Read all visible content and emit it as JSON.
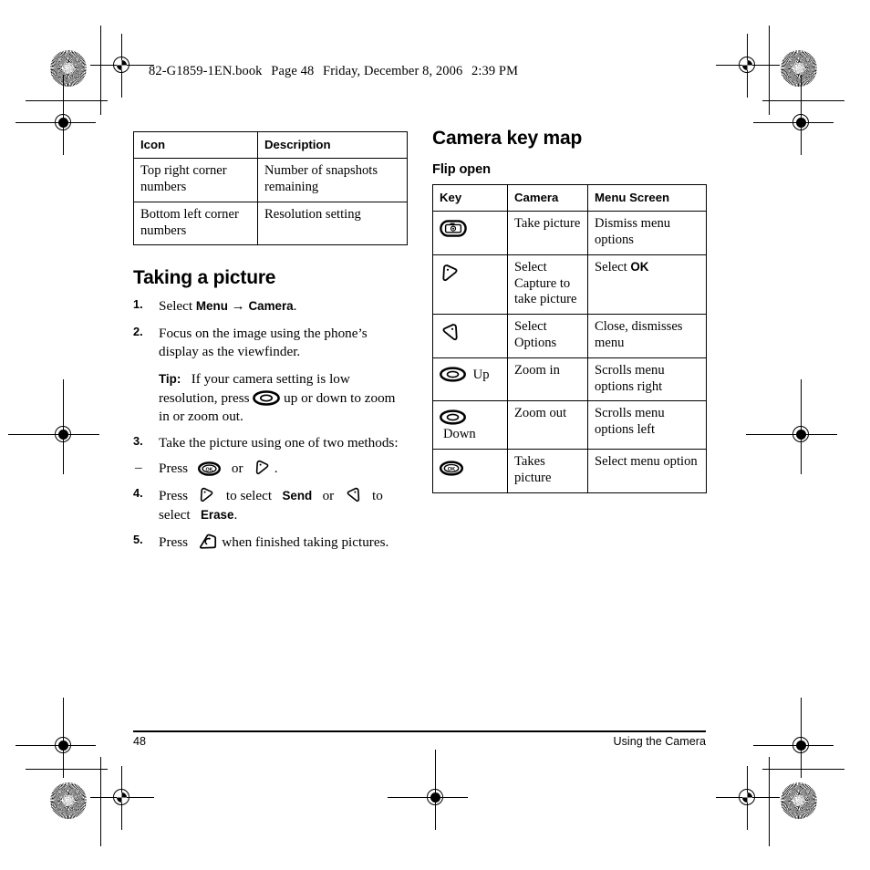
{
  "document": {
    "header_line": "82-G1859-1EN.book  Page 48  Friday, December 8, 2006  2:39 PM",
    "header_file": "82-G1859-1EN.book",
    "header_page": "Page 48",
    "header_date": "Friday, December 8, 2006",
    "header_time": "2:39 PM"
  },
  "icon_table": {
    "headers": [
      "Icon",
      "Description"
    ],
    "rows": [
      {
        "icon": "Top right corner numbers",
        "description": "Number of snapshots remaining"
      },
      {
        "icon": "Bottom left corner numbers",
        "description": "Resolution setting"
      }
    ]
  },
  "taking_a_picture": {
    "title": "Taking a picture",
    "steps": [
      {
        "num": "1.",
        "pre": "Select ",
        "bold1": "Menu",
        "arrow": "→",
        "bold2": "Camera",
        "post": "."
      },
      {
        "num": "2.",
        "text": "Focus on the image using the phone’s display as the viewfinder."
      },
      {
        "num": "3.",
        "text": "Take the picture using one of two methods:"
      }
    ],
    "tip": {
      "label": "Tip:",
      "text_before_icon": "If your camera setting is low resolution, press",
      "icon": "nav-key-icon",
      "text_after_icon": "up or down to zoom in or zoom out."
    },
    "substep": {
      "dash": "–",
      "press": "Press",
      "icon_ok": "ok-key-icon",
      "or": "or",
      "icon_softkey_left": "left-soft-key-icon",
      "period": "."
    },
    "step4": {
      "num": "4.",
      "press": "Press",
      "icon_left": "left-soft-key-icon",
      "to_select": "to select",
      "bold_send": "Send",
      "or": "or",
      "icon_right": "right-soft-key-icon",
      "to": "to",
      "select": "select",
      "bold_erase": "Erase",
      "period": "."
    },
    "step5": {
      "num": "5.",
      "press": "Press",
      "icon_end": "end-call-key-icon",
      "rest": "when finished taking pictures."
    }
  },
  "camera_key_map": {
    "title": "Camera key map",
    "subtitle": "Flip open",
    "headers": [
      "Key",
      "Camera",
      "Menu Screen"
    ],
    "rows": [
      {
        "key_icon": "camera-key-icon",
        "key_label": "",
        "camera": "Take picture",
        "menu_screen": "Dismiss menu options",
        "menu_bold": ""
      },
      {
        "key_icon": "left-soft-key-icon",
        "key_label": "",
        "camera": "Select Capture to take picture",
        "menu_screen": "Select ",
        "menu_bold": "OK"
      },
      {
        "key_icon": "right-soft-key-icon",
        "key_label": "",
        "camera": "Select Options",
        "menu_screen": "Close, dismisses menu",
        "menu_bold": ""
      },
      {
        "key_icon": "nav-key-icon",
        "key_label": "Up",
        "camera": "Zoom in",
        "menu_screen": "Scrolls menu options right",
        "menu_bold": ""
      },
      {
        "key_icon": "nav-key-icon",
        "key_label": "Down",
        "camera": "Zoom out",
        "menu_screen": "Scrolls menu options left",
        "menu_bold": ""
      },
      {
        "key_icon": "ok-key-icon",
        "key_label": "",
        "camera": "Takes picture",
        "menu_screen": "Select menu option",
        "menu_bold": ""
      }
    ]
  },
  "footer": {
    "page_number": "48",
    "section": "Using the Camera"
  },
  "colors": {
    "ink": "#000000",
    "paper": "#ffffff"
  }
}
